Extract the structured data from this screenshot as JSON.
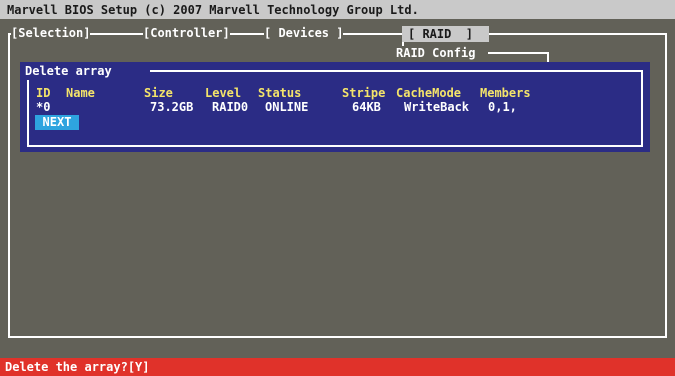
{
  "header": {
    "title": "Marvell BIOS Setup (c) 2007 Marvell Technology Group Ltd."
  },
  "tabs": [
    "[Selection]",
    "[Controller]",
    "[ Devices ]",
    "[ RAID  ]"
  ],
  "panel": {
    "title": "RAID Config"
  },
  "dialog": {
    "title": "Delete array",
    "columns": [
      "ID",
      "Name",
      "Size",
      "Level",
      "Status",
      "Stripe",
      "CacheMode",
      "Members"
    ],
    "rows": [
      {
        "id": "*0",
        "name": "",
        "size": "73.2GB",
        "level": "RAID0",
        "status": "ONLINE",
        "stripe": "64KB",
        "cachemode": "WriteBack",
        "members": "0,1,"
      }
    ],
    "next_label": "NEXT"
  },
  "status": {
    "prompt": "Delete the array?[Y]"
  },
  "colors": {
    "background": "#626158",
    "title_bar": "#c9c9c9",
    "dialog_bg": "#2b2c85",
    "header_text": "#f4e46a",
    "button_bg": "#2ea4df",
    "status_bar": "#e0322a"
  }
}
